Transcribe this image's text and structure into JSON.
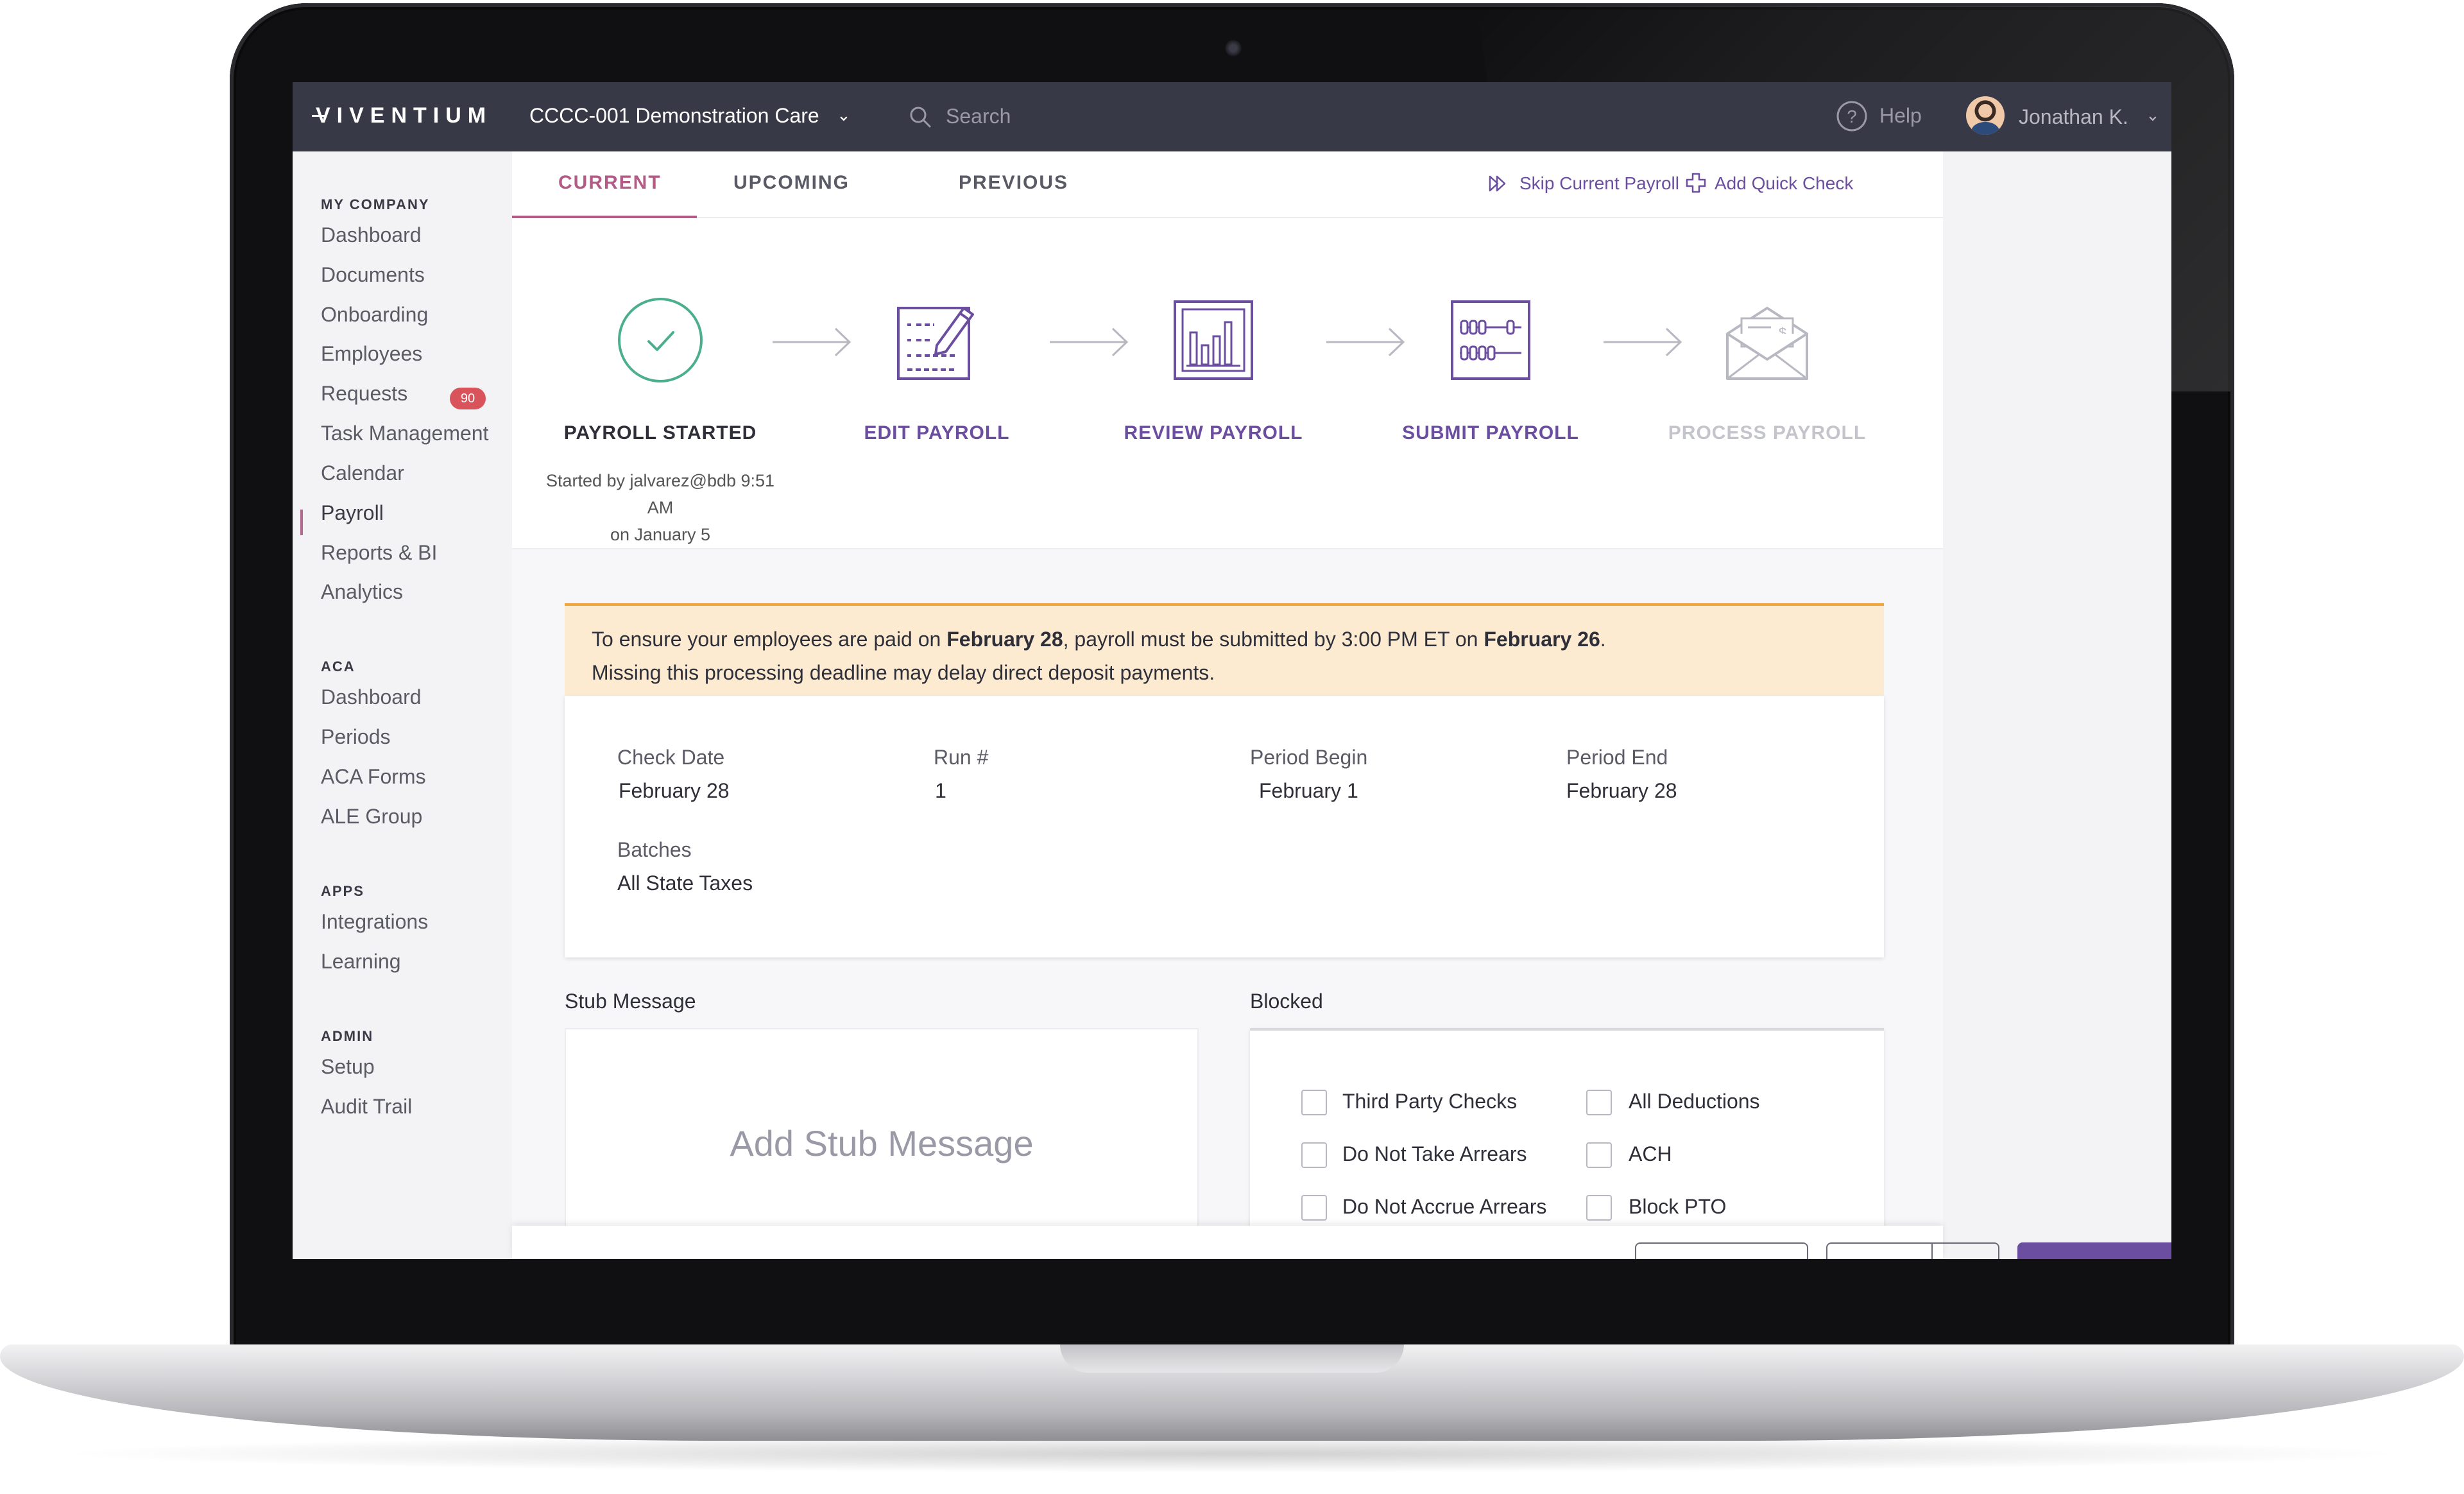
{
  "brand": {
    "logo": "VIVENTIUM"
  },
  "topbar": {
    "company": "CCCC-001 Demonstration Care",
    "search_placeholder": "Search",
    "help": "Help",
    "user": "Jonathan K."
  },
  "sidebar": {
    "my_company_head": "MY COMPANY",
    "my_company": [
      "Dashboard",
      "Documents",
      "Onboarding",
      "Employees",
      "Requests",
      "Task Management",
      "Calendar",
      "Payroll",
      "Reports & BI",
      "Analytics"
    ],
    "requests_badge": "90",
    "aca_head": "ACA",
    "aca": [
      "Dashboard",
      "Periods",
      "ACA Forms",
      "ALE Group"
    ],
    "apps_head": "APPS",
    "apps": [
      "Integrations",
      "Learning"
    ],
    "admin_head": "ADMIN",
    "admin": [
      "Setup",
      "Audit Trail"
    ],
    "active_item": "Payroll"
  },
  "tabs": {
    "current": "CURRENT",
    "upcoming": "UPCOMING",
    "previous": "PREVIOUS",
    "active": "CURRENT"
  },
  "actions": {
    "skip": "Skip Current Payroll",
    "add_quick_check": "Add Quick Check"
  },
  "steps": [
    {
      "label": "PAYROLL STARTED",
      "icon": "check-circle-icon",
      "state": "done"
    },
    {
      "label": "EDIT PAYROLL",
      "icon": "edit-form-icon",
      "state": "available"
    },
    {
      "label": "REVIEW PAYROLL",
      "icon": "bar-chart-icon",
      "state": "available"
    },
    {
      "label": "SUBMIT PAYROLL",
      "icon": "abacus-icon",
      "state": "available"
    },
    {
      "label": "PROCESS PAYROLL",
      "icon": "money-envelope-icon",
      "state": "disabled"
    }
  ],
  "step_note": {
    "line1": "Started by jalvarez@bdb 9:51 AM",
    "line2": "on January 5"
  },
  "notice": {
    "p1_a": "To ensure your employees are paid on ",
    "p1_b": "February 28",
    "p1_c": ", payroll must be submitted by 3:00 PM ET on ",
    "p1_d": "February 26",
    "p1_e": ".",
    "p2": "Missing this processing deadline may delay direct deposit payments."
  },
  "payroll_info": {
    "check_date_label": "Check Date",
    "check_date": "February 28",
    "run_label": "Run #",
    "run": "1",
    "period_begin_label": "Period Begin",
    "period_begin": "February 1",
    "period_end_label": "Period End",
    "period_end": "February 28",
    "batches_label": "Batches",
    "batches": "All State Taxes"
  },
  "stub": {
    "title": "Stub Message",
    "placeholder": "Add Stub Message"
  },
  "blocked": {
    "title": "Blocked",
    "options": [
      {
        "label": "Third Party Checks",
        "checked": false
      },
      {
        "label": "All Deductions",
        "checked": false
      },
      {
        "label": "Do Not Take Arrears",
        "checked": false
      },
      {
        "label": "ACH",
        "checked": false
      },
      {
        "label": "Do Not Accrue Arrears",
        "checked": false
      },
      {
        "label": "Block PTO",
        "checked": false
      }
    ]
  },
  "colors": {
    "accent": "#6b4ea0",
    "tab_active": "#b35a86",
    "topbar": "#383946",
    "notice_bg": "#fcebd0",
    "notice_border": "#f0a53a",
    "success": "#4caf8c",
    "badge": "#d9535a"
  }
}
